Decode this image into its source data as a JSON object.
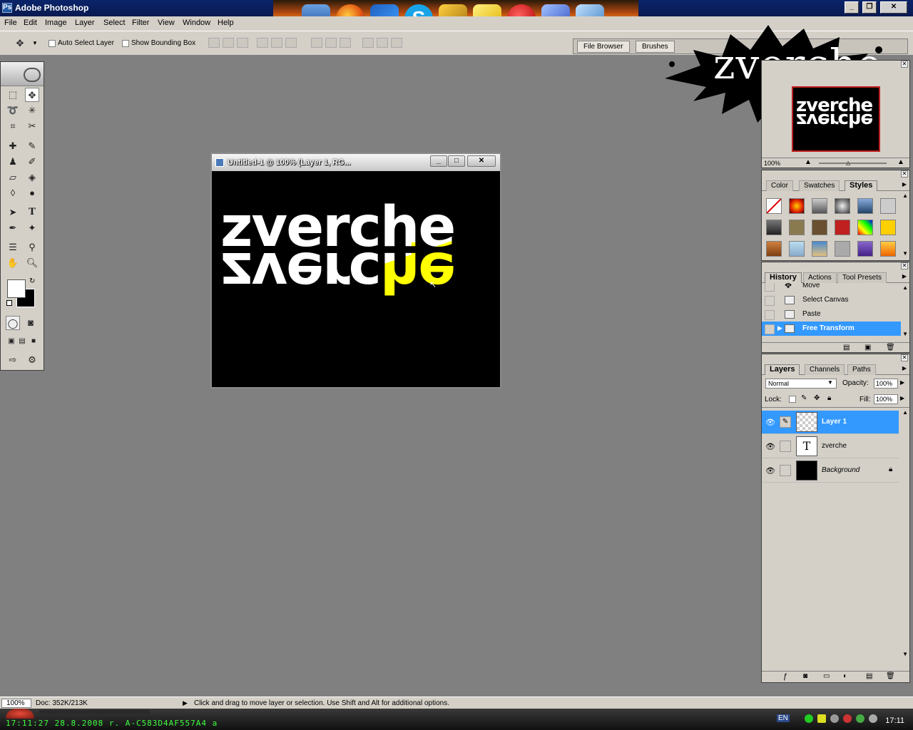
{
  "app": {
    "title": "Adobe Photoshop"
  },
  "menu": [
    "File",
    "Edit",
    "Image",
    "Layer",
    "Select",
    "Filter",
    "View",
    "Window",
    "Help"
  ],
  "options": {
    "auto_select_label": "Auto Select Layer",
    "show_bounding_box_label": "Show Bounding Box",
    "file_browser_tab": "File Browser",
    "brushes_tab": "Brushes"
  },
  "logo": {
    "text": "zverche"
  },
  "document": {
    "title": "Untitled-1 @ 100% (Layer 1, RG...",
    "canvas_text": "zverche",
    "colors": {
      "text": "#ffffff",
      "highlight": "#ffff00",
      "background": "#000000"
    }
  },
  "navigator": {
    "zoom": "100%"
  },
  "styles_palette": {
    "tabs": [
      "Color",
      "Swatches",
      "Styles"
    ],
    "active_tab": "Styles"
  },
  "history_palette": {
    "tabs": [
      "History",
      "Actions",
      "Tool Presets"
    ],
    "active_tab": "History",
    "items": [
      {
        "label": "Move"
      },
      {
        "label": "Select Canvas"
      },
      {
        "label": "Paste"
      },
      {
        "label": "Free Transform",
        "selected": true
      }
    ]
  },
  "layers_palette": {
    "tabs": [
      "Layers",
      "Channels",
      "Paths"
    ],
    "active_tab": "Layers",
    "blend_mode": "Normal",
    "opacity_label": "Opacity:",
    "opacity": "100%",
    "lock_label": "Lock:",
    "fill_label": "Fill:",
    "fill": "100%",
    "layers": [
      {
        "name": "Layer 1",
        "selected": true,
        "thumb": "transparent"
      },
      {
        "name": "zverche",
        "selected": false,
        "thumb": "T"
      },
      {
        "name": "Background",
        "selected": false,
        "thumb": "black",
        "locked": true
      }
    ]
  },
  "status": {
    "zoom": "100%",
    "doc": "Doc: 352K/213K",
    "hint": "Click and drag to move layer or selection.  Use Shift and Alt for additional options."
  },
  "taskbar": {
    "ticker": "17:11:27 28.8.2008 r. A-C583D4AF557A4 a",
    "lang": "EN",
    "clock": "17:11"
  }
}
